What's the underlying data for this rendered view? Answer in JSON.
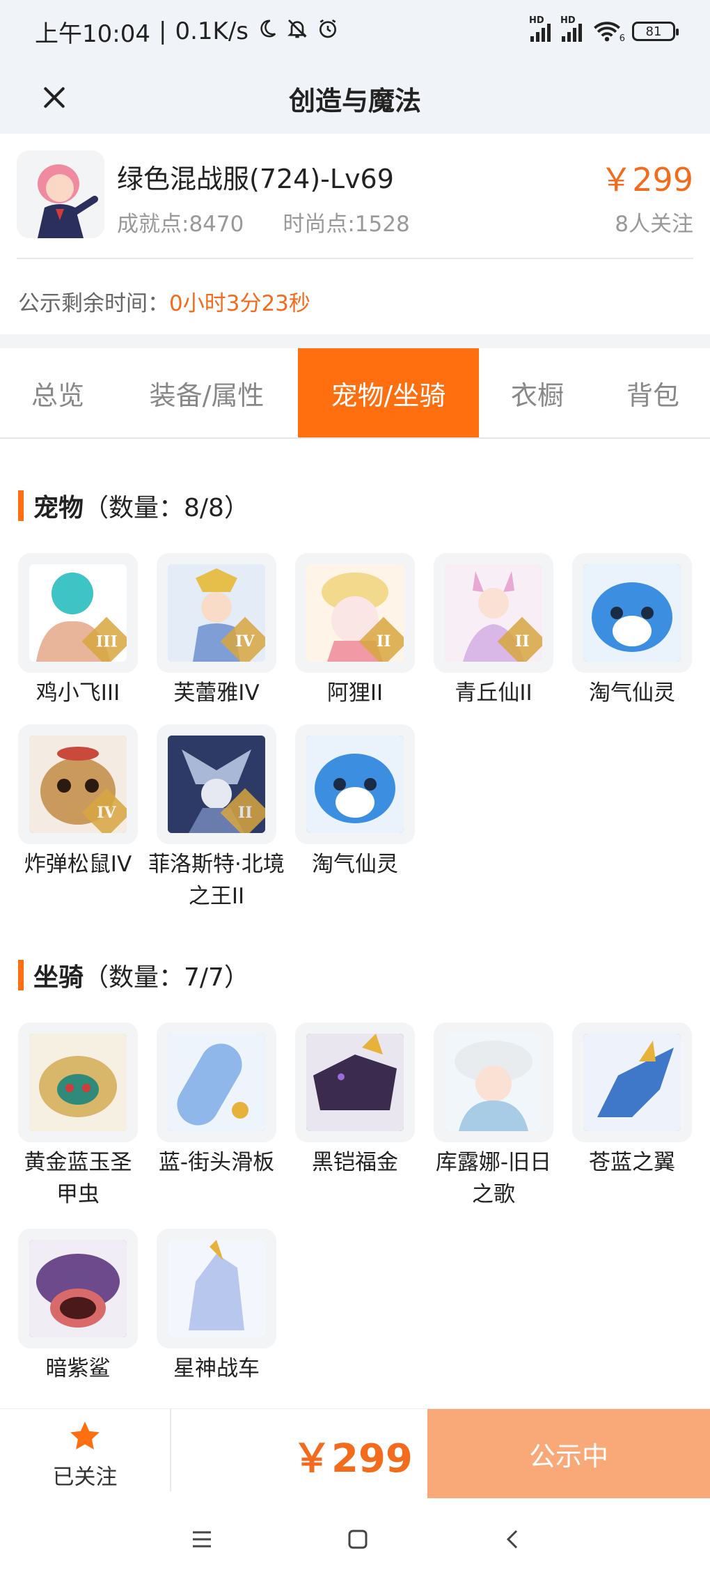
{
  "status_bar": {
    "time": "上午10:04",
    "speed": "0.1K/s",
    "signal1_label": "HD",
    "signal2_label": "HD",
    "wifi_label": "6",
    "battery": "81",
    "icons": [
      "moon-icon",
      "bell-off-icon",
      "alarm-icon",
      "signal-icon",
      "wifi-icon",
      "battery-icon"
    ]
  },
  "navbar": {
    "close_icon": "close-icon",
    "title": "创造与魔法"
  },
  "product": {
    "name": "绿色混战服(724)-Lv69",
    "achievement": "成就点:8470",
    "fashion": "时尚点:1528",
    "price": "￥299",
    "followers": "8人关注",
    "public_label": "公示剩余时间：",
    "public_time": "0小时3分23秒"
  },
  "tabs": [
    {
      "label": "总览",
      "active": false
    },
    {
      "label": "装备/属性",
      "active": false
    },
    {
      "label": "宠物/坐骑",
      "active": true
    },
    {
      "label": "衣橱",
      "active": false
    },
    {
      "label": "背包",
      "active": false
    }
  ],
  "pets": {
    "title": "宠物",
    "count": "（数量：8/8）",
    "items": [
      {
        "name": "鸡小飞III",
        "grade": "III",
        "color": "#e8b49a"
      },
      {
        "name": "芙蕾雅IV",
        "grade": "IV",
        "color": "#c9d8ef"
      },
      {
        "name": "阿狸II",
        "grade": "II",
        "color": "#f3d98c"
      },
      {
        "name": "青丘仙II",
        "grade": "II",
        "color": "#e9c3df"
      },
      {
        "name": "淘气仙灵",
        "grade": "",
        "color": "#3c8fe0"
      },
      {
        "name": "炸弹松鼠IV",
        "grade": "IV",
        "color": "#c99a5c"
      },
      {
        "name": "菲洛斯特·北境之王II",
        "grade": "II",
        "color": "#2d3a66"
      },
      {
        "name": "淘气仙灵",
        "grade": "",
        "color": "#3c8fe0"
      }
    ]
  },
  "mounts": {
    "title": "坐骑",
    "count": "（数量：7/7）",
    "items": [
      {
        "name": "黄金蓝玉圣甲虫",
        "color": "#d8b66a"
      },
      {
        "name": "蓝-街头滑板",
        "color": "#8fb7ea"
      },
      {
        "name": "黑铠福金",
        "color": "#3b2b4e"
      },
      {
        "name": "库露娜-旧日之歌",
        "color": "#a8cbe6"
      },
      {
        "name": "苍蓝之翼",
        "color": "#3f78c8"
      },
      {
        "name": "暗紫鲨",
        "color": "#6d4a8c"
      },
      {
        "name": "星神战车",
        "color": "#b7c7ee"
      }
    ]
  },
  "bottom": {
    "fav_icon": "star-icon",
    "fav_label": "已关注",
    "price": "￥299",
    "action": "公示中"
  },
  "system_nav": [
    "menu-icon",
    "home-icon",
    "back-icon"
  ],
  "colors": {
    "accent": "#ff6f0f",
    "price": "#f36b1c",
    "button_disabled": "#f9a877"
  }
}
